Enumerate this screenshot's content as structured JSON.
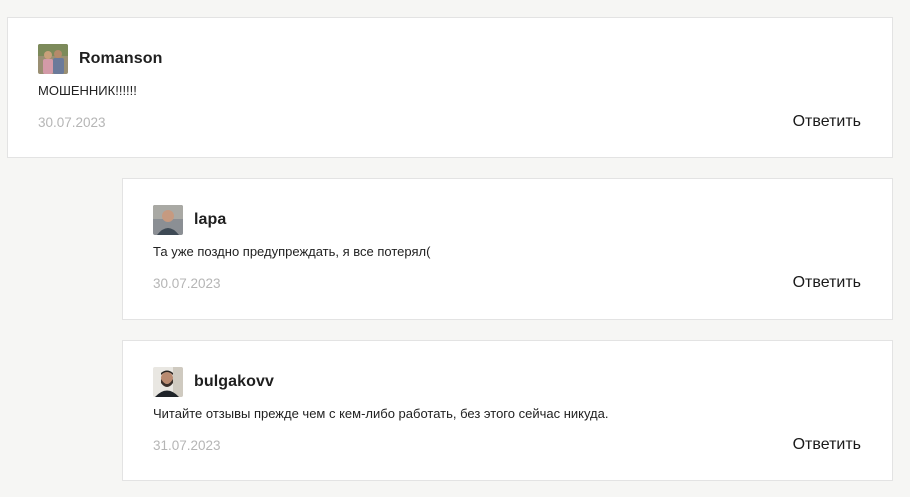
{
  "comments": [
    {
      "username": "Romanson",
      "avatar_icon": "user-photo-couple",
      "text": "МОШЕННИК!!!!!!",
      "date": "30.07.2023",
      "reply_label": "Ответить"
    },
    {
      "username": "lapa",
      "avatar_icon": "user-photo-man",
      "text": "Та уже поздно предупреждать, я все потерял(",
      "date": "30.07.2023",
      "reply_label": "Ответить"
    },
    {
      "username": "bulgakovv",
      "avatar_icon": "user-photo-bearded-man",
      "text": "Читайте отзывы прежде чем с кем-либо работать, без этого сейчас никуда.",
      "date": "31.07.2023",
      "reply_label": "Ответить"
    }
  ]
}
